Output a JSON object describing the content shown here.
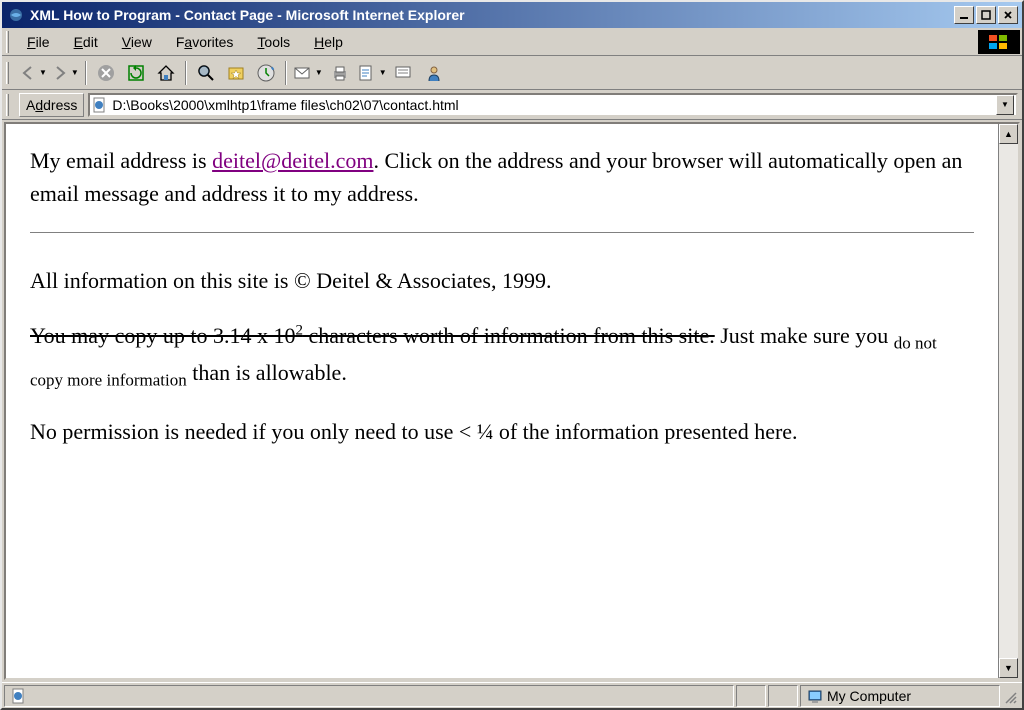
{
  "window": {
    "title": "XML How to Program - Contact Page - Microsoft Internet Explorer"
  },
  "menu": {
    "file": "File",
    "edit": "Edit",
    "view": "View",
    "favorites": "Favorites",
    "tools": "Tools",
    "help": "Help"
  },
  "address": {
    "label": "Address",
    "value": "D:\\Books\\2000\\xmlhtp1\\frame files\\ch02\\07\\contact.html"
  },
  "page": {
    "intro_before": "My email address is ",
    "email": "deitel@deitel.com",
    "intro_after": ". Click on the address and your browser will automatically open an email message and address it to my address.",
    "copyright": "All information on this site is © Deitel & Associates, 1999.",
    "strike_part": "You may copy up to 3.14 x 10",
    "strike_sup": "2",
    "strike_part2": " characters worth of information from this site.",
    "after_strike1": " Just make sure you ",
    "sub_text": "do not copy more information",
    "after_strike2": " than is allowable.",
    "permission": "No permission is needed if you only need to use < ¼ of the information presented here."
  },
  "status": {
    "zone": "My Computer"
  }
}
